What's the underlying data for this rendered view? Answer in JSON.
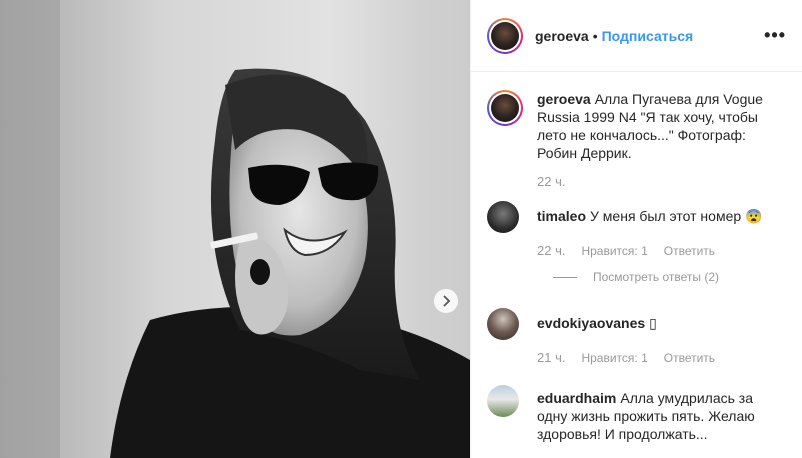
{
  "post": {
    "username": "geroeva",
    "separator": "•",
    "follow_label": "Подписаться",
    "more_icon": "•••",
    "caption_user": "geroeva",
    "caption_text": "Алла Пугачева для Vogue Russia 1999 N4 \"Я так хочу, чтобы лето не кончалось...\" Фотограф: Робин Деррик.",
    "caption_time": "22 ч."
  },
  "comments": [
    {
      "user": "timaleo",
      "text": "У меня был этот номер 😨",
      "time": "22 ч.",
      "likes": "Нравится: 1",
      "reply": "Ответить",
      "view_replies": "Посмотреть ответы (2)"
    },
    {
      "user": "evdokiyaovanes",
      "text": "▯",
      "time": "21 ч.",
      "likes": "Нравится: 1",
      "reply": "Ответить"
    },
    {
      "user": "eduardhaim",
      "text": "Алла умудрилась за одну жизнь прожить пять. Желаю здоровья! И продолжать..."
    }
  ],
  "icons": {
    "next": "chevron-right-icon",
    "more": "more-icon"
  }
}
